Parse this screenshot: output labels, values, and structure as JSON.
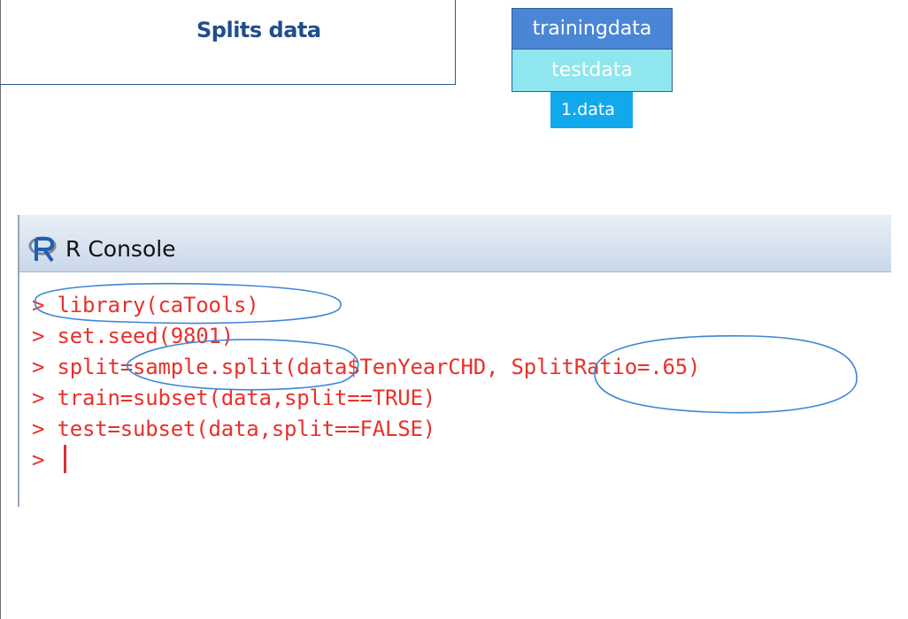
{
  "slide": {
    "title": "Splits data"
  },
  "data_stack": {
    "training": "trainingdata",
    "test": "testdata",
    "data": "1.data"
  },
  "console": {
    "title": "R Console",
    "prompt": ">",
    "lines": [
      "library(caTools)",
      "set.seed(9801)",
      "split=sample.split(data$TenYearCHD, SplitRatio=.65)",
      "train=subset(data,split==TRUE)",
      "test=subset(data,split==FALSE)"
    ]
  },
  "colors": {
    "title": "#1f4e8c",
    "training": "#4a86d6",
    "test": "#8ee6ee",
    "data": "#12a9ec",
    "code": "#e8312c",
    "annotation": "#3e86d6"
  },
  "icons": {
    "console_logo": "r-logo-icon"
  }
}
